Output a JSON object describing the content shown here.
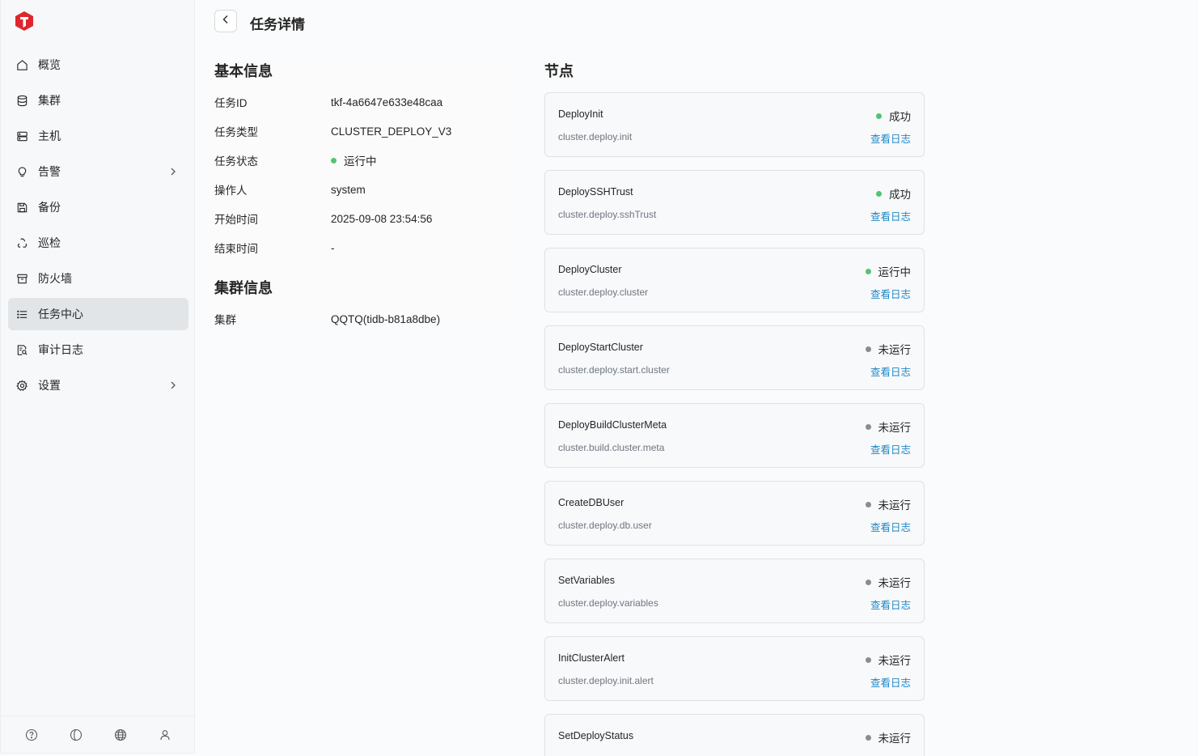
{
  "sidebar": {
    "items": [
      {
        "label": "概览",
        "icon": "home-icon"
      },
      {
        "label": "集群",
        "icon": "database-icon"
      },
      {
        "label": "主机",
        "icon": "server-icon"
      },
      {
        "label": "告警",
        "icon": "bulb-icon",
        "has_submenu": true
      },
      {
        "label": "备份",
        "icon": "save-icon"
      },
      {
        "label": "巡检",
        "icon": "recycle-icon"
      },
      {
        "label": "防火墙",
        "icon": "archive-icon"
      },
      {
        "label": "任务中心",
        "icon": "list-icon",
        "active": true
      },
      {
        "label": "审计日志",
        "icon": "file-search-icon"
      },
      {
        "label": "设置",
        "icon": "gear-icon",
        "has_submenu": true
      }
    ],
    "footer_icons": [
      "help-icon",
      "theme-icon",
      "globe-icon",
      "user-icon"
    ]
  },
  "header": {
    "title": "任务详情"
  },
  "basic_info": {
    "title": "基本信息",
    "rows": [
      {
        "label": "任务ID",
        "value": "tkf-4a6647e633e48caa"
      },
      {
        "label": "任务类型",
        "value": "CLUSTER_DEPLOY_V3"
      },
      {
        "label": "任务状态",
        "value": "运行中",
        "status_color": "#52c472"
      },
      {
        "label": "操作人",
        "value": "system"
      },
      {
        "label": "开始时间",
        "value": "2025-09-08 23:54:56"
      },
      {
        "label": "结束时间",
        "value": "-"
      }
    ]
  },
  "cluster_info": {
    "title": "集群信息",
    "label": "集群",
    "value": "QQTQ(tidb-b81a8dbe)"
  },
  "nodes": {
    "title": "节点",
    "log_label": "查看日志",
    "items": [
      {
        "name": "DeployInit",
        "key": "cluster.deploy.init",
        "status": "成功",
        "status_color": "#52c472"
      },
      {
        "name": "DeploySSHTrust",
        "key": "cluster.deploy.sshTrust",
        "status": "成功",
        "status_color": "#52c472"
      },
      {
        "name": "DeployCluster",
        "key": "cluster.deploy.cluster",
        "status": "运行中",
        "status_color": "#52c472"
      },
      {
        "name": "DeployStartCluster",
        "key": "cluster.deploy.start.cluster",
        "status": "未运行",
        "status_color": "#8c8c8c"
      },
      {
        "name": "DeployBuildClusterMeta",
        "key": "cluster.build.cluster.meta",
        "status": "未运行",
        "status_color": "#8c8c8c"
      },
      {
        "name": "CreateDBUser",
        "key": "cluster.deploy.db.user",
        "status": "未运行",
        "status_color": "#8c8c8c"
      },
      {
        "name": "SetVariables",
        "key": "cluster.deploy.variables",
        "status": "未运行",
        "status_color": "#8c8c8c"
      },
      {
        "name": "InitClusterAlert",
        "key": "cluster.deploy.init.alert",
        "status": "未运行",
        "status_color": "#8c8c8c"
      },
      {
        "name": "SetDeployStatus",
        "key": "",
        "status": "未运行",
        "status_color": "#8c8c8c"
      }
    ]
  },
  "colors": {
    "brand": "#e0262d",
    "link": "#1e88c7",
    "success": "#52c472",
    "idle": "#8c8c8c"
  }
}
